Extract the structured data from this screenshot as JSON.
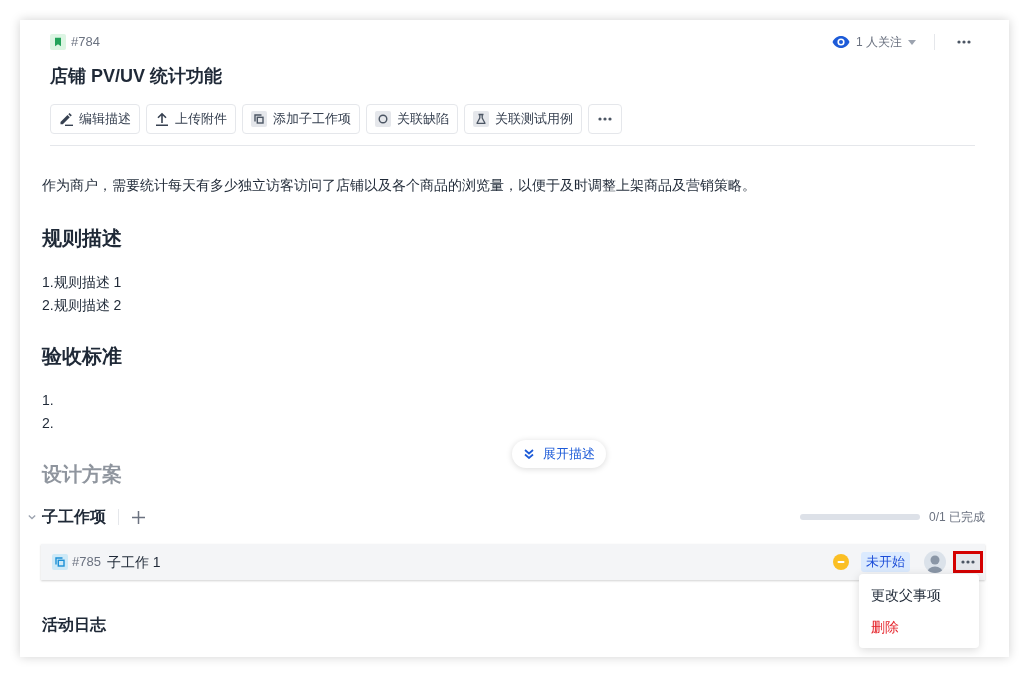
{
  "item": {
    "id": "#784",
    "title": "店铺 PV/UV 统计功能"
  },
  "watch": {
    "label": "1 人关注"
  },
  "toolbar": [
    {
      "label": "编辑描述"
    },
    {
      "label": "上传附件"
    },
    {
      "label": "添加子工作项"
    },
    {
      "label": "关联缺陷"
    },
    {
      "label": "关联测试用例"
    }
  ],
  "description": {
    "text": "作为商户，需要统计每天有多少独立访客访问了店铺以及各个商品的浏览量，以便于及时调整上架商品及营销策略。",
    "sections": [
      {
        "heading": "规则描述",
        "faded": false,
        "lines": [
          "1.规则描述 1",
          "2.规则描述 2"
        ]
      },
      {
        "heading": "验收标准",
        "faded": false,
        "lines": [
          "1.",
          "2."
        ]
      },
      {
        "heading": "设计方案",
        "faded": true
      }
    ],
    "expand_button": "展开描述"
  },
  "subtasks": {
    "title": "子工作项",
    "expanded": true,
    "progress": {
      "level": 0,
      "reading": "0/1 已完成"
    },
    "rows": [
      {
        "id": "#785",
        "title": "子工作 1",
        "status": "未开始",
        "highlighted": true,
        "menu_open": true,
        "menu": [
          {
            "label": "更改父事项",
            "kind": "normal"
          },
          {
            "label": "删除",
            "kind": "danger"
          }
        ]
      }
    ]
  },
  "activity": {
    "title": "活动日志"
  }
}
